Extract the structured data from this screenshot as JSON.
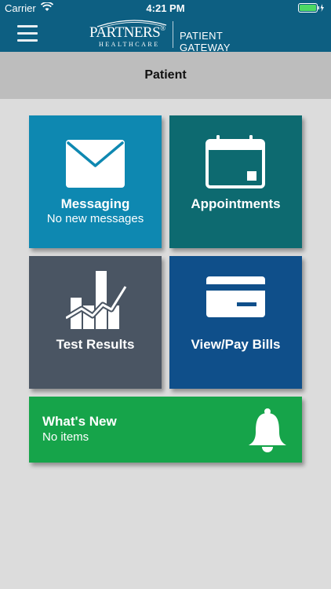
{
  "status_bar": {
    "carrier": "Carrier",
    "time": "4:21 PM"
  },
  "header": {
    "logo_main": "PARTNERS",
    "logo_registered": "®",
    "logo_sub": "HEALTHCARE",
    "app_name": "PATIENT GATEWAY",
    "menu_icon": "hamburger-menu-icon"
  },
  "subheader": {
    "title": "Patient"
  },
  "tiles": [
    {
      "title": "Messaging",
      "subtitle": "No new messages",
      "icon": "envelope-icon",
      "color": "#0e88b1"
    },
    {
      "title": "Appointments",
      "subtitle": "",
      "icon": "calendar-icon",
      "color": "#0d6a70"
    },
    {
      "title": "Test Results",
      "subtitle": "",
      "icon": "bar-chart-icon",
      "color": "#4a5563"
    },
    {
      "title": "View/Pay Bills",
      "subtitle": "",
      "icon": "credit-card-icon",
      "color": "#0f4f8a"
    }
  ],
  "whats_new": {
    "title": "What's New",
    "subtitle": "No items",
    "icon": "bell-icon",
    "color": "#16a44a"
  },
  "colors": {
    "header": "#0d5f82",
    "subheader": "#bdbdbd",
    "background": "#dcdcdc"
  }
}
